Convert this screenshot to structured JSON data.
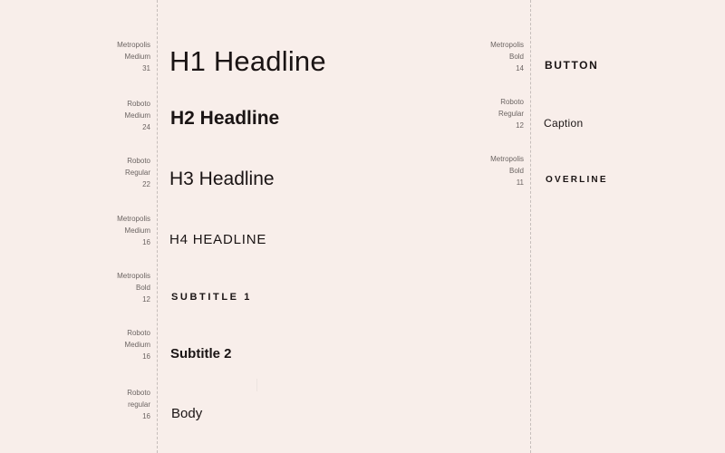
{
  "styles": {
    "h1": {
      "font_lines": [
        "Metropolis",
        "Medium",
        "31"
      ],
      "sample": "H1 Headline"
    },
    "h2": {
      "font_lines": [
        "Roboto",
        "Medium",
        "24"
      ],
      "sample": "H2 Headline"
    },
    "h3": {
      "font_lines": [
        "Roboto",
        "Regular",
        "22"
      ],
      "sample": "H3 Headline"
    },
    "h4": {
      "font_lines": [
        "Metropolis",
        "Medium",
        "16"
      ],
      "sample": "H4 HEADLINE"
    },
    "subtitle1": {
      "font_lines": [
        "Metropolis",
        "Bold",
        "12"
      ],
      "sample": "SUBTITLE 1"
    },
    "subtitle2": {
      "font_lines": [
        "Roboto",
        "Medium",
        "16"
      ],
      "sample": "Subtitle 2"
    },
    "body": {
      "font_lines": [
        "Roboto",
        "regular",
        "16"
      ],
      "sample": "Body"
    },
    "button": {
      "font_lines": [
        "Metropolis",
        "Bold",
        "14"
      ],
      "sample": "BUTTON"
    },
    "caption": {
      "font_lines": [
        "Roboto",
        "Regular",
        "12"
      ],
      "sample": "Caption"
    },
    "overline": {
      "font_lines": [
        "Metropolis",
        "Bold",
        "11"
      ],
      "sample": "OVERLINE"
    }
  },
  "colors": {
    "background": "#f8eeea",
    "text": "#1a1414",
    "spec_text": "#6b6462",
    "guide": "#c6bebb"
  }
}
